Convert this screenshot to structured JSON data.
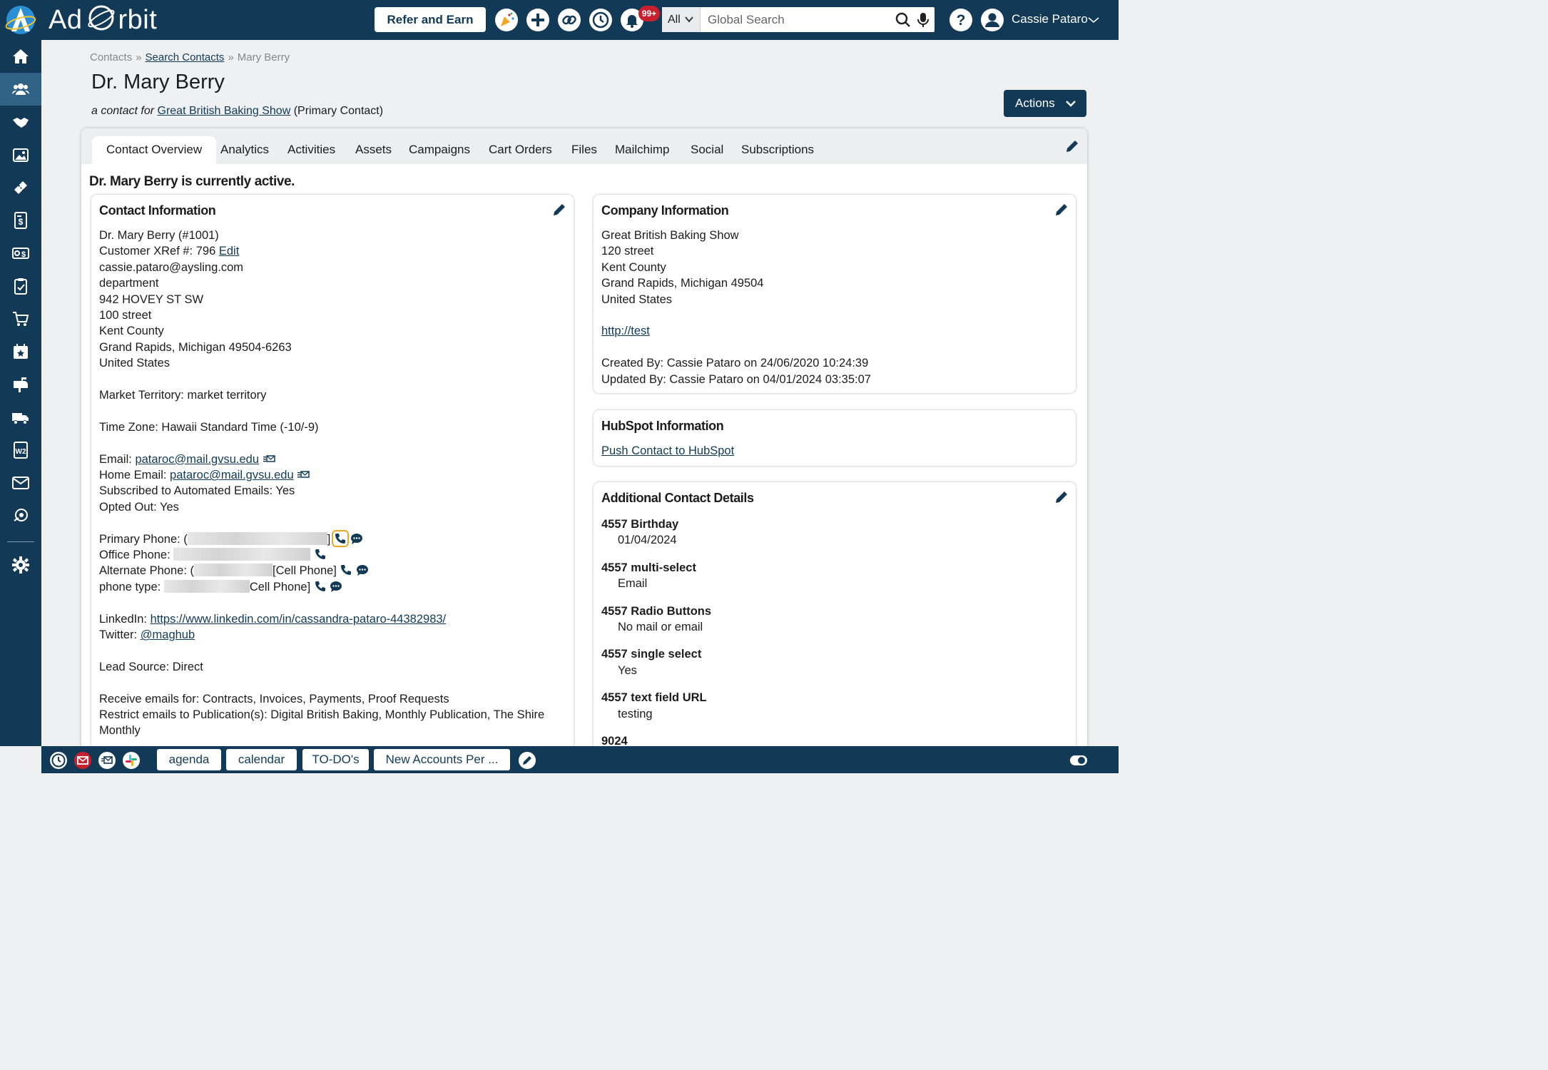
{
  "brand": {
    "name_left": "Ad",
    "name_right": "rbit"
  },
  "topbar": {
    "refer_label": "Refer and Earn",
    "notification_count": "99+",
    "search_scope": "All",
    "search_placeholder": "Global Search",
    "user_name": "Cassie Pataro"
  },
  "breadcrumb": {
    "root": "Contacts",
    "link": "Search Contacts",
    "current": "Mary Berry"
  },
  "page": {
    "title": "Dr. Mary Berry",
    "subtitle_prefix": "a contact for",
    "company_link": "Great British Baking Show",
    "subtitle_suffix": "(Primary Contact)",
    "actions_label": "Actions",
    "status": "Dr. Mary Berry is currently active."
  },
  "tabs": [
    "Contact Overview",
    "Analytics",
    "Activities",
    "Assets",
    "Campaigns",
    "Cart Orders",
    "Files",
    "Mailchimp",
    "Social",
    "Subscriptions"
  ],
  "contact": {
    "title": "Contact Information",
    "name_line": "Dr. Mary Berry (#1001)",
    "xref_label": "Customer XRef #: 796",
    "xref_edit": "Edit",
    "email_line": "cassie.pataro@aysling.com",
    "address": [
      "department",
      "942 HOVEY ST SW",
      "100 street",
      "Kent County",
      "Grand Rapids, Michigan 49504-6263",
      "United States"
    ],
    "market": "Market Territory: market territory",
    "timezone": "Time Zone: Hawaii Standard Time (-10/-9)",
    "email_label": "Email:",
    "email_value": "pataroc@mail.gvsu.edu",
    "home_email_label": "Home Email:",
    "home_email_value": "pataroc@mail.gvsu.edu",
    "subscribed": "Subscribed to Automated Emails: Yes",
    "opted_out": "Opted Out: Yes",
    "primary_phone_label": "Primary Phone: (",
    "primary_phone_tail": "]",
    "office_phone_label": "Office Phone:",
    "alternate_phone_label": "Alternate Phone: (",
    "alternate_phone_tail": "[Cell Phone]",
    "phone_type_label": "phone type:",
    "phone_type_tail": "Cell Phone]",
    "linkedin_label": "LinkedIn:",
    "linkedin_value": "https://www.linkedin.com/in/cassandra-pataro-44382983/",
    "twitter_label": "Twitter:",
    "twitter_value": "@maghub",
    "lead_source": "Lead Source: Direct",
    "receive_emails": "Receive emails for: Contracts, Invoices, Payments, Proof Requests",
    "restrict_emails": "Restrict emails to Publication(s): Digital British Baking, Monthly Publication, The Shire",
    "restrict_emails_2": "Monthly"
  },
  "company": {
    "title": "Company Information",
    "lines": [
      "Great British Baking Show",
      "120 street",
      "Kent County",
      "Grand Rapids, Michigan 49504",
      "United States"
    ],
    "url": "http://test",
    "created": "Created By: Cassie Pataro on 24/06/2020 10:24:39",
    "updated": "Updated By: Cassie Pataro on 04/01/2024 03:35:07"
  },
  "hubspot": {
    "title": "HubSpot Information",
    "link": "Push Contact to HubSpot"
  },
  "details": {
    "title": "Additional Contact Details",
    "items": [
      {
        "term": "4557 Birthday",
        "value": "01/04/2024"
      },
      {
        "term": "4557 multi-select",
        "value": "Email"
      },
      {
        "term": "4557 Radio Buttons",
        "value": "No mail or email"
      },
      {
        "term": "4557 single select",
        "value": "Yes"
      },
      {
        "term": "4557 text field URL",
        "value": "testing"
      },
      {
        "term": "9024",
        "value": ""
      }
    ]
  },
  "footer": {
    "buttons": [
      "agenda",
      "calendar",
      "TO-DO's",
      "New Accounts Per ..."
    ]
  },
  "colors": {
    "navy": "#123a56",
    "active_nav": "#2f6284",
    "badge_red": "#c8202e",
    "highlight": "#f2a623"
  }
}
